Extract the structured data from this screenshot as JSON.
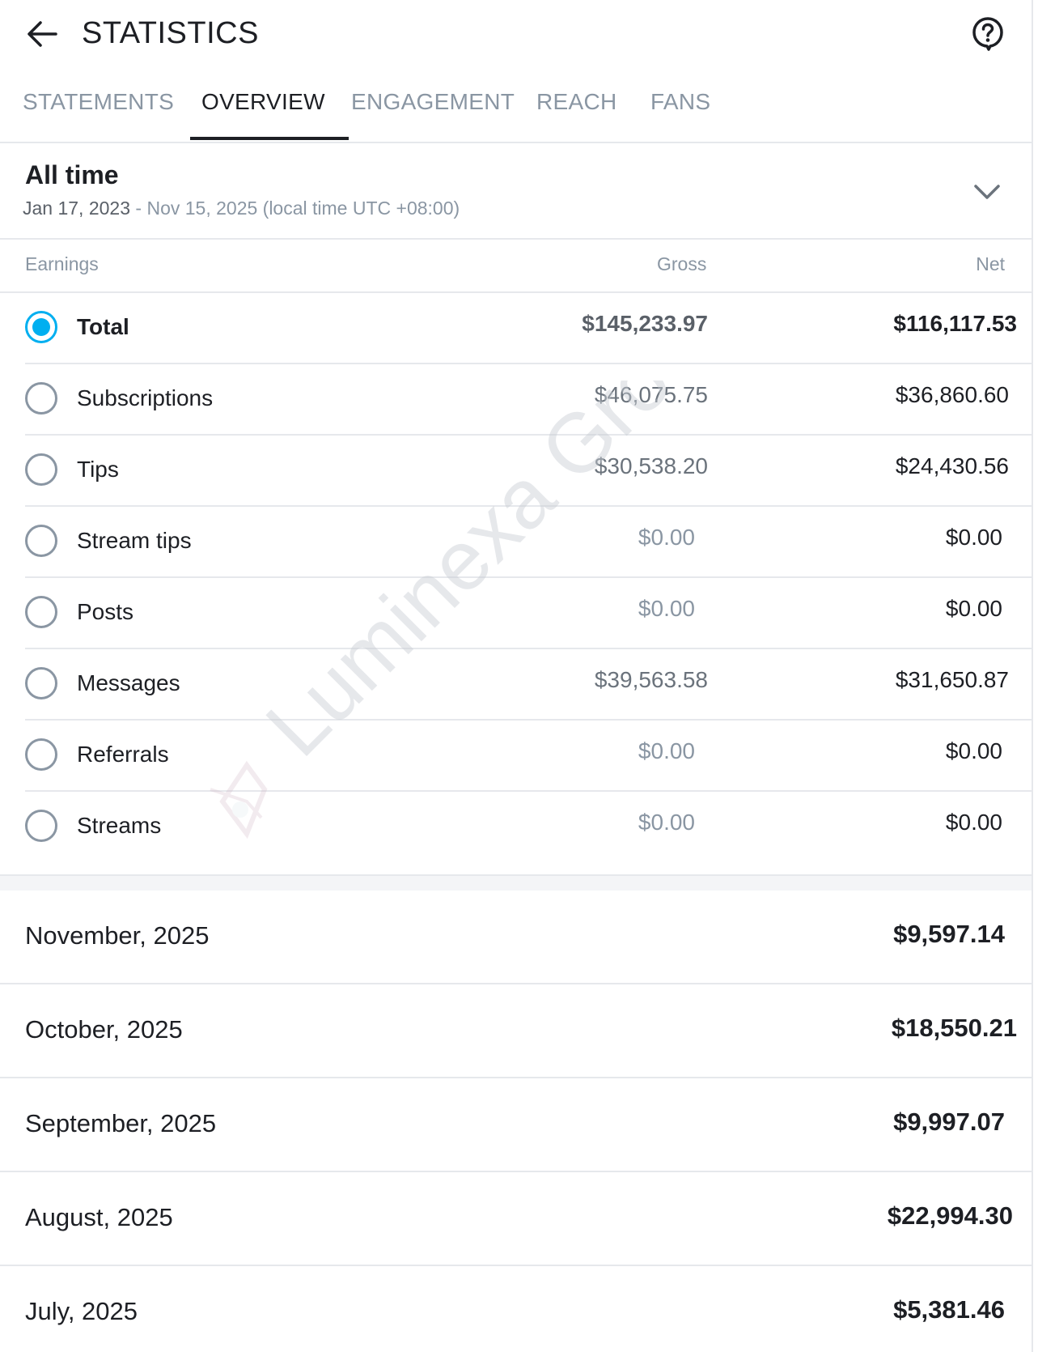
{
  "header": {
    "title": "STATISTICS",
    "back_icon": "arrow-left-icon",
    "help_icon": "help-circle-icon"
  },
  "tabs": [
    {
      "label": "STATEMENTS",
      "active": false
    },
    {
      "label": "OVERVIEW",
      "active": true
    },
    {
      "label": "ENGAGEMENT",
      "active": false
    },
    {
      "label": "REACH",
      "active": false
    },
    {
      "label": "FANS",
      "active": false
    }
  ],
  "period": {
    "title": "All time",
    "start": "Jan 17, 2023",
    "rest": " - Nov 15, 2025 (local time UTC +08:00)",
    "chevron_icon": "chevron-down-icon"
  },
  "earnings_table": {
    "headers": {
      "earnings": "Earnings",
      "gross": "Gross",
      "net": "Net"
    },
    "rows": [
      {
        "label": "Total",
        "gross": "$145,233.97",
        "net": "$116,117.53",
        "selected": true
      },
      {
        "label": "Subscriptions",
        "gross": "$46,075.75",
        "net": "$36,860.60",
        "selected": false
      },
      {
        "label": "Tips",
        "gross": "$30,538.20",
        "net": "$24,430.56",
        "selected": false
      },
      {
        "label": "Stream tips",
        "gross": "$0.00",
        "net": "$0.00",
        "selected": false
      },
      {
        "label": "Posts",
        "gross": "$0.00",
        "net": "$0.00",
        "selected": false
      },
      {
        "label": "Messages",
        "gross": "$39,563.58",
        "net": "$31,650.87",
        "selected": false
      },
      {
        "label": "Referrals",
        "gross": "$0.00",
        "net": "$0.00",
        "selected": false
      },
      {
        "label": "Streams",
        "gross": "$0.00",
        "net": "$0.00",
        "selected": false
      }
    ]
  },
  "months": [
    {
      "label": "November, 2025",
      "amount": "$9,597.14"
    },
    {
      "label": "October, 2025",
      "amount": "$18,550.21"
    },
    {
      "label": "September, 2025",
      "amount": "$9,997.07"
    },
    {
      "label": "August, 2025",
      "amount": "$22,994.30"
    },
    {
      "label": "July, 2025",
      "amount": "$5,381.46"
    }
  ],
  "watermark": {
    "text": "Luminexa Group",
    "icon": "luminexa-logo-icon"
  },
  "colors": {
    "accent": "#00aff0",
    "muted": "#8a96a3",
    "text": "#1d1f24",
    "divider": "#e6e8ec"
  }
}
